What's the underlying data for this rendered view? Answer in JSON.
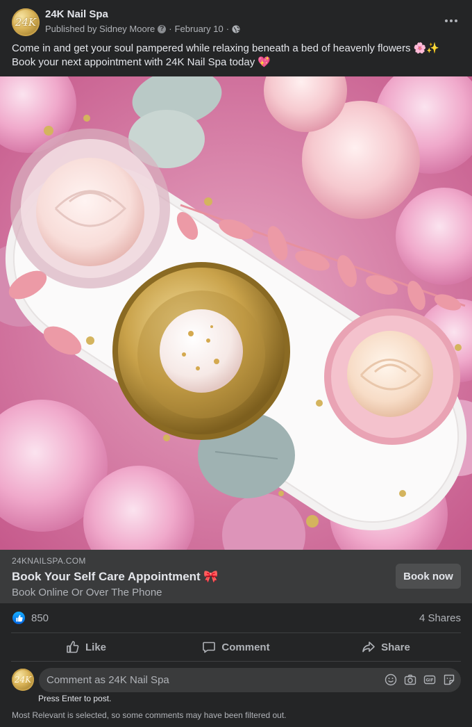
{
  "post": {
    "page_name": "24K Nail Spa",
    "avatar_monogram": "24K",
    "published_by": "Published by Sidney Moore",
    "date": "February 10",
    "separator": "·",
    "caption_line1": "Come in and get your soul pampered while relaxing beneath a bed of heavenly flowers 🌸✨",
    "caption_line2": "Book your next appointment with 24K Nail Spa today 💖"
  },
  "link_preview": {
    "domain": "24KNAILSPA.COM",
    "title": "Book Your Self Care Appointment 🎀",
    "description": "Book Online Or Over The Phone",
    "cta_label": "Book now"
  },
  "reactions": {
    "count": "850",
    "shares": "4 Shares"
  },
  "actions": {
    "like": "Like",
    "comment": "Comment",
    "share": "Share"
  },
  "comment_box": {
    "placeholder": "Comment as 24K Nail Spa",
    "hint": "Press Enter to post.",
    "filter_note": "Most Relevant is selected, so some comments may have been filtered out."
  },
  "icons": {
    "more": "more-horizontal-icon",
    "audience": "globe-icon",
    "like_reaction": "thumbs-up-icon",
    "emoji": "smiley-icon",
    "camera": "camera-icon",
    "gif": "gif-icon",
    "sticker": "sticker-icon"
  },
  "colors": {
    "background": "#242526",
    "card": "#3a3b3c",
    "text_primary": "#e4e6eb",
    "text_secondary": "#b0b3b8",
    "like_blue": "#1877f2"
  }
}
